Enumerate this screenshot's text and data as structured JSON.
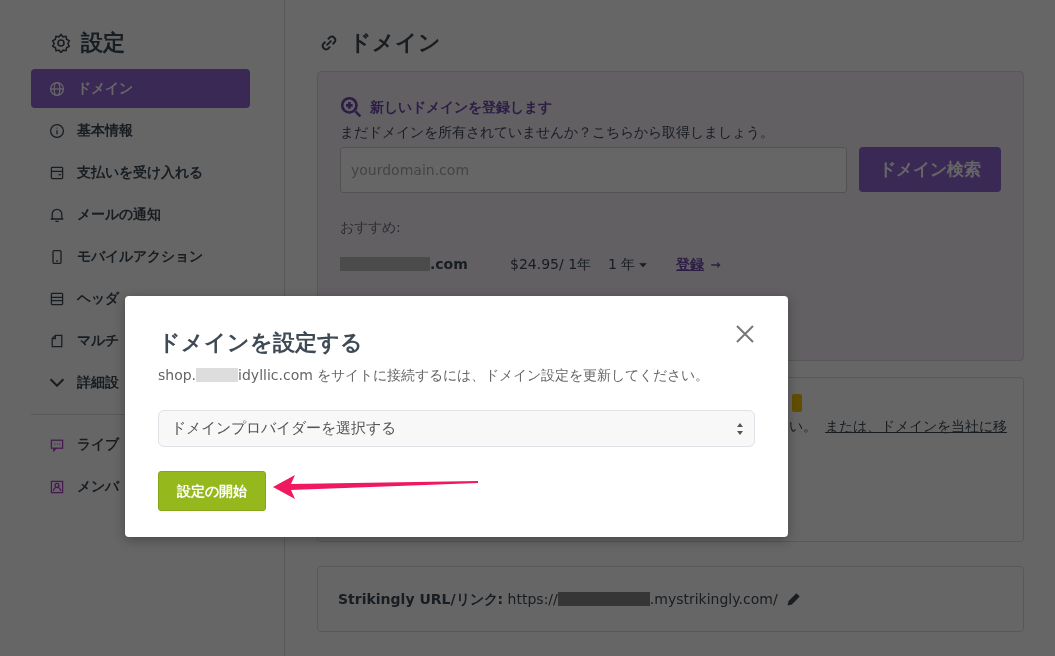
{
  "sidebar": {
    "title": "設定",
    "items": [
      {
        "label": "ドメイン",
        "selected": true
      },
      {
        "label": "基本情報",
        "selected": false
      },
      {
        "label": "支払いを受け入れる",
        "selected": false
      },
      {
        "label": "メールの通知",
        "selected": false
      },
      {
        "label": "モバイルアクション",
        "selected": false
      },
      {
        "label": "ヘッダ",
        "selected": false
      },
      {
        "label": "マルチ",
        "selected": false
      },
      {
        "label": "詳細設",
        "selected": false
      }
    ],
    "extra_items": [
      {
        "label": "ライブ"
      },
      {
        "label": "メンバ"
      }
    ]
  },
  "main": {
    "title": "ドメイン",
    "register_card": {
      "heading": "新しいドメインを登録します",
      "text": "まだドメインを所有されていませんか？こちらから取得しましょう。",
      "search": {
        "placeholder": "yourdomain.com"
      },
      "button": "ドメイン検索",
      "recommend_label": "おすすめ:",
      "suggestions": [
        {
          "domain": ".com",
          "price": "$24.95/ 1年",
          "term": "1 年",
          "action": "登録"
        }
      ]
    },
    "connect_card": {
      "text": "い。",
      "link": "または、ドメインを当社に移"
    },
    "url_card": {
      "label": "Strikingly URL/リンク:",
      "prefix": "https://",
      "suffix": ".mystrikingly.com/"
    }
  },
  "modal": {
    "title": "ドメインを設定する",
    "text_prefix": "shop.",
    "text_suffix": "idyllic.com をサイトに接続するには、ドメイン設定を更新してください。",
    "select": {
      "value": "ドメインプロバイダーを選択する"
    },
    "button": "設定の開始"
  }
}
